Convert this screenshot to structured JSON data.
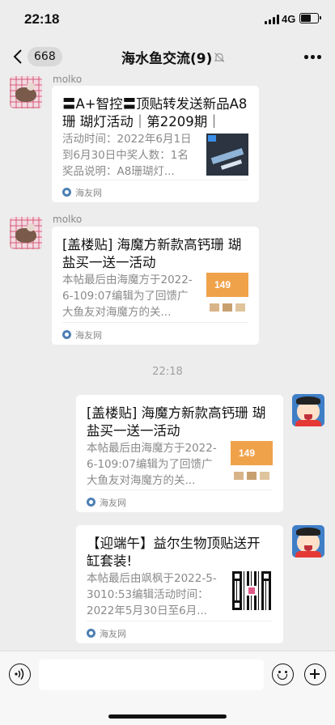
{
  "status_bar": {
    "time": "22:18",
    "network": "4G",
    "icons": [
      "signal-icon",
      "battery-icon"
    ]
  },
  "nav": {
    "unread_count": "668",
    "title": "海水鱼交流(9)",
    "icons": [
      "back-icon",
      "mute-icon",
      "more-icon"
    ]
  },
  "chat": {
    "timestamp": "22:18",
    "messages": [
      {
        "sender": "molko",
        "side": "left",
        "card": {
          "title": "〓A+智控〓顶贴转发送新品A8珊 瑚灯活动｜第2209期｜",
          "desc": "活动时间：2022年6月1日到6月30日中奖人数：1名奖品说明：A8珊瑚灯...",
          "source": "海友网"
        }
      },
      {
        "sender": "molko",
        "side": "left",
        "card": {
          "title": "[盖楼贴] 海魔方新款高钙珊 瑚盐买一送一活动",
          "desc": "本帖最后由海魔方于2022-6-109:07编辑为了回馈广大鱼友对海魔方的关...",
          "source": "海友网",
          "thumb_text": "149"
        }
      },
      {
        "sender": "",
        "side": "right",
        "card": {
          "title": "[盖楼贴] 海魔方新款高钙珊 瑚盐买一送一活动",
          "desc": "本帖最后由海魔方于2022-6-109:07编辑为了回馈广大鱼友对海魔方的关...",
          "source": "海友网",
          "thumb_text": "149"
        }
      },
      {
        "sender": "",
        "side": "right",
        "card": {
          "title": "【迎端午】益尔生物顶贴送开缸套装!",
          "desc": "本帖最后由飒枫于2022-5-3010:53编辑活动时间：2022年5月30日至6月...",
          "source": "海友网"
        }
      }
    ]
  },
  "input_bar": {
    "icons": [
      "voice-icon",
      "emoji-icon",
      "plus-icon"
    ]
  }
}
